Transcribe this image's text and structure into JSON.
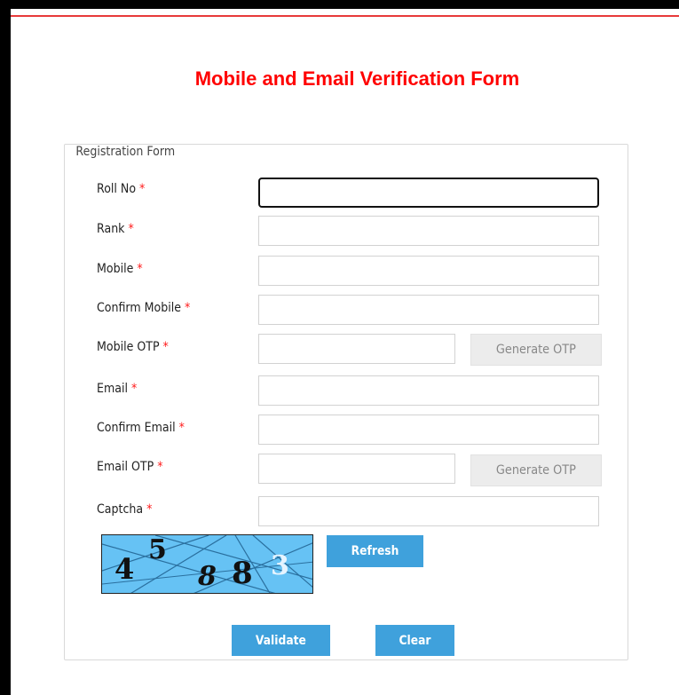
{
  "page": {
    "title": "Mobile and Email Verification Form"
  },
  "form": {
    "legend": "Registration Form",
    "required_mark": "*",
    "fields": [
      {
        "label": "Roll No",
        "value": ""
      },
      {
        "label": "Rank",
        "value": ""
      },
      {
        "label": "Mobile",
        "value": ""
      },
      {
        "label": "Confirm Mobile",
        "value": ""
      },
      {
        "label": "Mobile OTP",
        "value": ""
      },
      {
        "label": "Email",
        "value": ""
      },
      {
        "label": "Confirm Email",
        "value": ""
      },
      {
        "label": "Email OTP",
        "value": ""
      },
      {
        "label": "Captcha",
        "value": ""
      }
    ],
    "generate_otp_label": "Generate OTP",
    "refresh_label": "Refresh",
    "validate_label": "Validate",
    "clear_label": "Clear"
  },
  "captcha": {
    "chars": [
      "4",
      "5",
      "8",
      "8",
      "3"
    ],
    "background_color": "#66c2f4"
  },
  "colors": {
    "title": "#ff0000",
    "required": "#ff1a1a",
    "button": "#3fa1dc",
    "disabled_button": "#ececec",
    "header_rule": "#e83a3a"
  }
}
